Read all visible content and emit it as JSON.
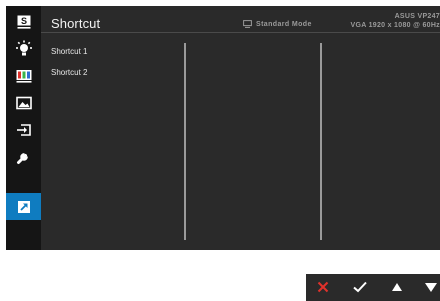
{
  "header": {
    "title": "Shortcut",
    "mode": "Standard Mode",
    "model": "ASUS VP247",
    "signal": "VGA 1920 x 1080 @ 60Hz"
  },
  "shortcut_list": {
    "items": [
      "Shortcut 1",
      "Shortcut 2"
    ]
  },
  "sidebar": {
    "items": [
      {
        "icon": "splendid-s-icon"
      },
      {
        "icon": "brightness-icon"
      },
      {
        "icon": "color-bars-icon"
      },
      {
        "icon": "image-icon"
      },
      {
        "icon": "input-select-icon"
      },
      {
        "icon": "wrench-icon"
      },
      {
        "icon": "shortcut-arrow-icon",
        "active": true
      }
    ]
  },
  "bottom_buttons": [
    {
      "icon": "close-icon",
      "color": "#e0312b"
    },
    {
      "icon": "check-icon",
      "color": "#ffffff"
    },
    {
      "icon": "up-arrow-icon",
      "color": "#ffffff"
    },
    {
      "icon": "down-arrow-icon",
      "color": "#ffffff"
    }
  ],
  "colors": {
    "accent": "#0f7cc0",
    "panel": "#2a2a2a",
    "sidebar": "#151515",
    "exit": "#e0312b"
  }
}
